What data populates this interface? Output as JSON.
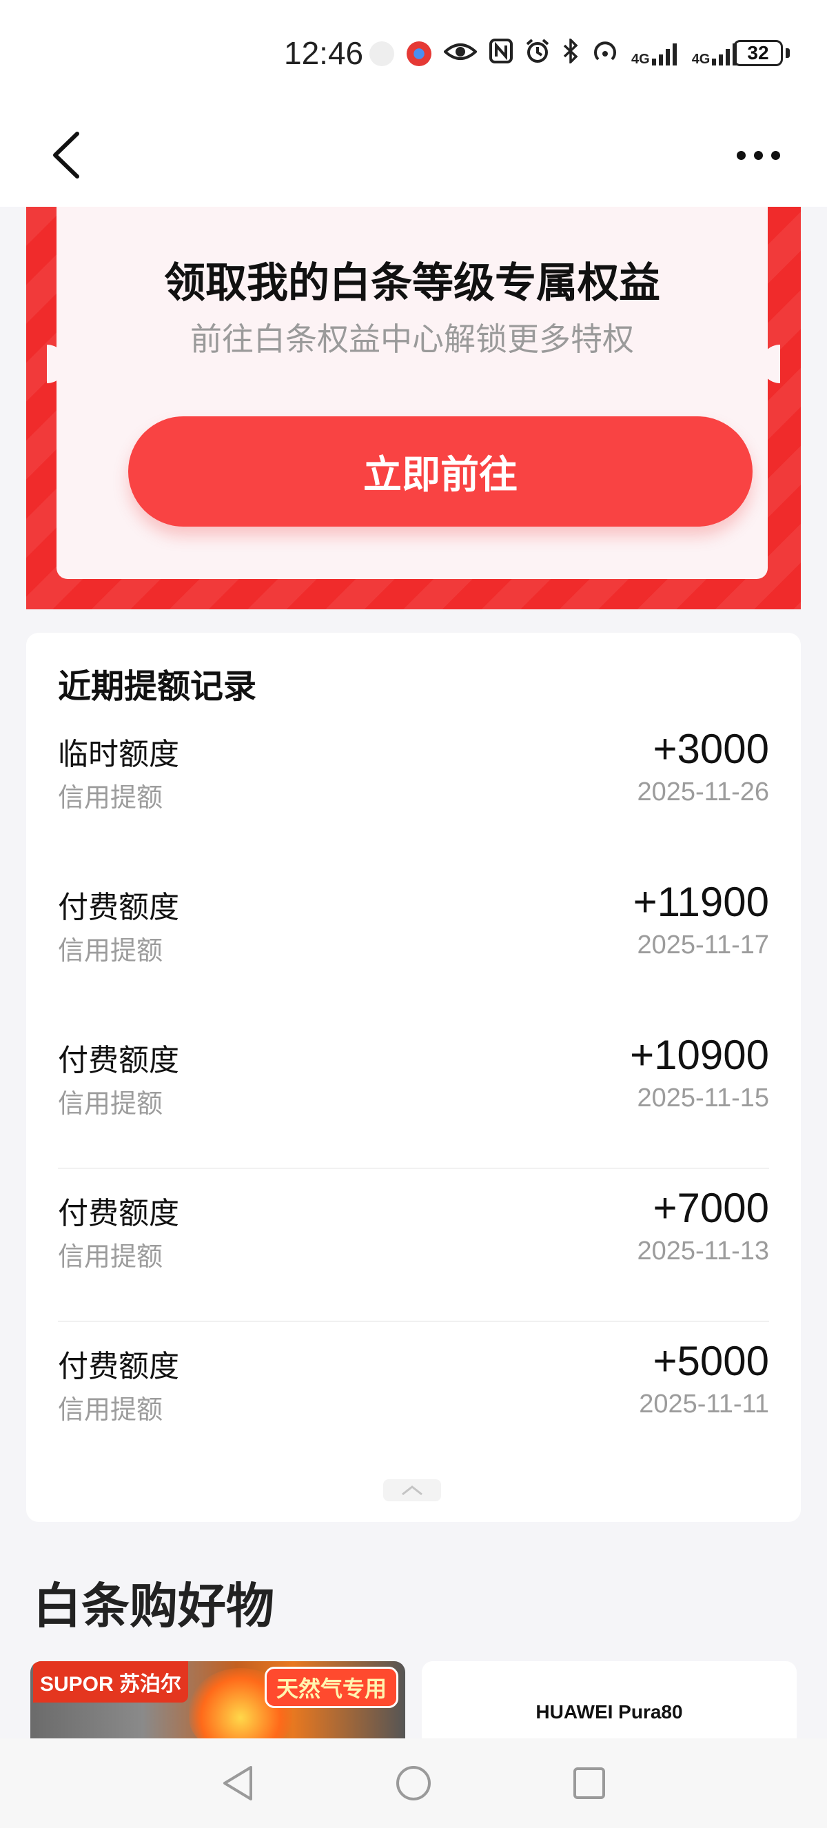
{
  "status_bar": {
    "time": "12:46",
    "signal_1": "4G",
    "signal_2": "4G",
    "battery": "32",
    "icons": [
      "huawei-app-icon",
      "red-app-icon",
      "eye-icon",
      "nfc-icon",
      "alarm-icon",
      "bluetooth-icon",
      "hotspot-icon",
      "signal-icon",
      "signal-icon",
      "battery-icon"
    ]
  },
  "nav": {
    "back_icon": "chevron-left-icon",
    "more_icon": "more-dots-icon"
  },
  "banner": {
    "title": "领取我的白条等级专属权益",
    "subtitle": "前往白条权益中心解锁更多特权",
    "button_label": "立即前往",
    "accent_color": "#f94343"
  },
  "records": {
    "title": "近期提额记录",
    "items": [
      {
        "label": "临时额度",
        "sub": "信用提额",
        "amount": "+3000",
        "date": "2025-11-26"
      },
      {
        "label": "付费额度",
        "sub": "信用提额",
        "amount": "+11900",
        "date": "2025-11-17"
      },
      {
        "label": "付费额度",
        "sub": "信用提额",
        "amount": "+10900",
        "date": "2025-11-15"
      },
      {
        "label": "付费额度",
        "sub": "信用提额",
        "amount": "+7000",
        "date": "2025-11-13"
      },
      {
        "label": "付费额度",
        "sub": "信用提额",
        "amount": "+5000",
        "date": "2025-11-11"
      }
    ],
    "collapse_icon": "chevron-up-icon"
  },
  "shop": {
    "title": "白条购好物",
    "product_1": {
      "brand": "SUPOR 苏泊尔",
      "tag": "天然气专用"
    },
    "product_2": {
      "brand": "HUAWEI Pura80"
    }
  },
  "system_nav": [
    "back-triangle-icon",
    "home-circle-icon",
    "recents-square-icon"
  ]
}
